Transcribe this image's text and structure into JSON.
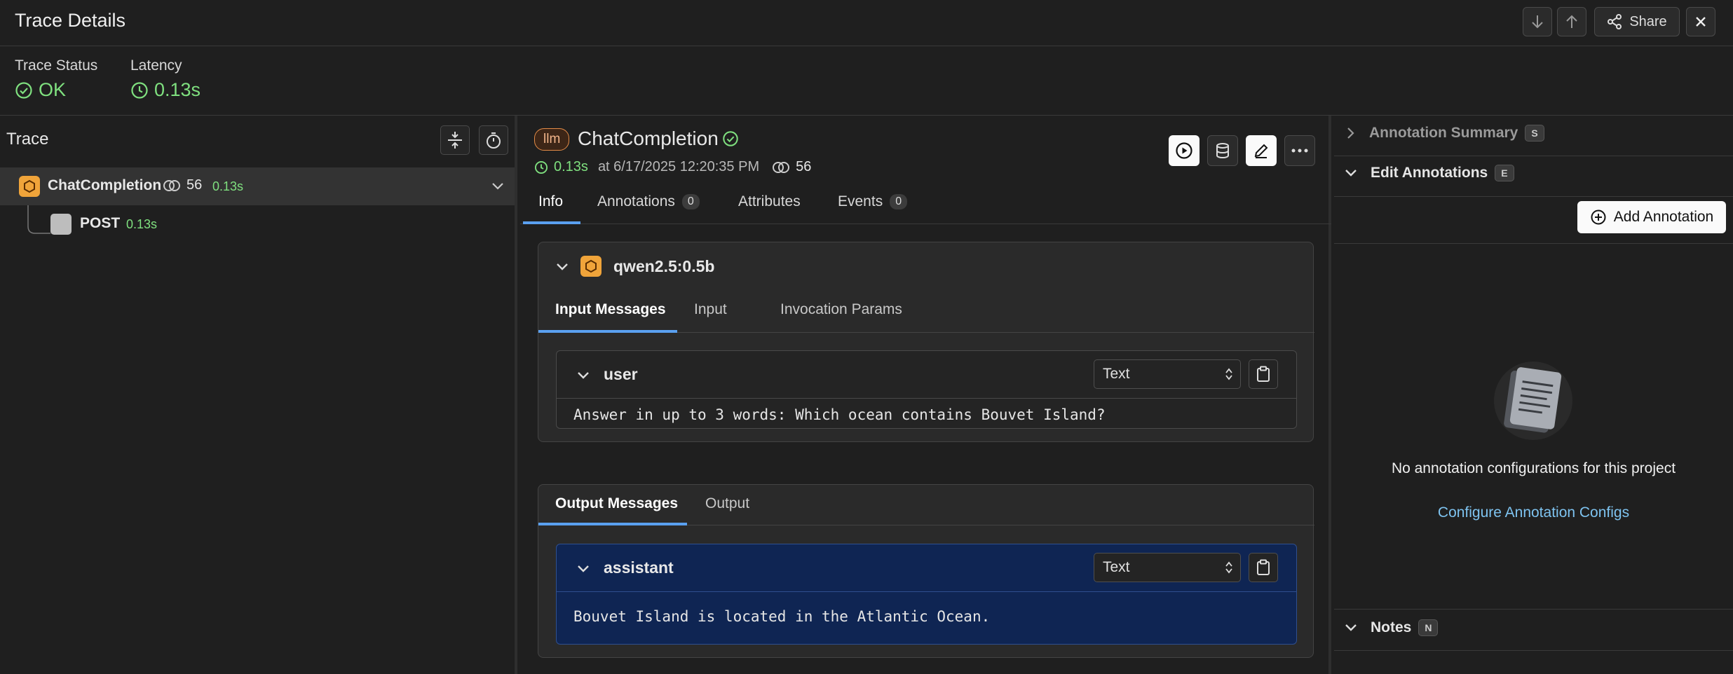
{
  "header": {
    "title": "Trace Details",
    "share_label": "Share"
  },
  "status": {
    "trace_status_label": "Trace Status",
    "trace_status_value": "OK",
    "latency_label": "Latency",
    "latency_value": "0.13s"
  },
  "trace_tree": {
    "title": "Trace",
    "root": {
      "name": "ChatCompletion",
      "tokens": "56",
      "latency": "0.13s"
    },
    "child": {
      "name": "POST",
      "latency": "0.13s"
    }
  },
  "span": {
    "kind": "llm",
    "name": "ChatCompletion",
    "latency": "0.13s",
    "timestamp": "at 6/17/2025 12:20:35 PM",
    "tokens": "56",
    "tabs": [
      {
        "label": "Info"
      },
      {
        "label": "Annotations",
        "count": "0"
      },
      {
        "label": "Attributes"
      },
      {
        "label": "Events",
        "count": "0"
      }
    ],
    "model": "qwen2.5:0.5b",
    "input_tabs": [
      "Input Messages",
      "Input",
      "Invocation Params"
    ],
    "input_message": {
      "role": "user",
      "format": "Text",
      "content": "Answer in up to 3 words: Which ocean contains Bouvet Island?"
    },
    "output_tabs": [
      "Output Messages",
      "Output"
    ],
    "output_message": {
      "role": "assistant",
      "format": "Text",
      "content": "Bouvet Island is located in the Atlantic Ocean."
    }
  },
  "annotations": {
    "summary_label": "Annotation Summary",
    "summary_key": "S",
    "edit_label": "Edit Annotations",
    "edit_key": "E",
    "add_label": "Add Annotation",
    "empty_text": "No annotation configurations for this project",
    "configure_link": "Configure Annotation Configs",
    "notes_label": "Notes",
    "notes_key": "N"
  },
  "colors": {
    "accent_green": "#7fe07f",
    "assistant_bg": "#0f2553",
    "link": "#7ec3f0",
    "llm_orange": "#f0a43a"
  }
}
